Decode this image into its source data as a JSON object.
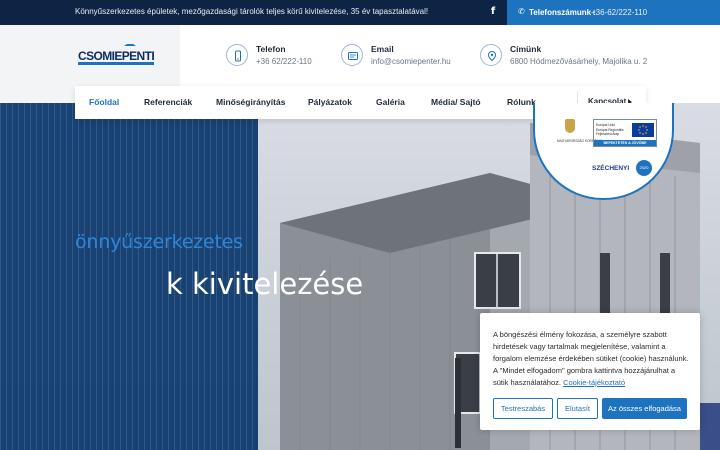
{
  "topbar": {
    "tagline": "Könnyűszerkezetes épületek, mezőgazdasági tárolók teljes körű kivitelezése, 35 év tapasztalatával!",
    "facebook_icon": "facebook-icon",
    "phone_label": "Telefonszámunk :",
    "phone_value": "+36-62/222-110"
  },
  "logo": {
    "text": "CSOMIEPENTER"
  },
  "header": {
    "contacts": [
      {
        "icon": "phone-icon",
        "label": "Telefon",
        "value": "+36 62/222-110"
      },
      {
        "icon": "mail-icon",
        "label": "Email",
        "value": "info@csomiepenter.hu"
      },
      {
        "icon": "location-icon",
        "label": "Címünk",
        "value": "6800 Hódmezővásárhely, Majolika u. 2"
      }
    ]
  },
  "nav": {
    "items": [
      {
        "label": "Főoldal",
        "active": true
      },
      {
        "label": "Referenciák"
      },
      {
        "label": "Minőségirányítás"
      },
      {
        "label": "Pályázatok"
      },
      {
        "label": "Galéria"
      },
      {
        "label": "Média/ Sajtó"
      },
      {
        "label": "Rólunk"
      }
    ],
    "contact_label": "Kapcsolat"
  },
  "hero": {
    "headline_1": "önnyűszerkezetes",
    "headline_2": "k kivitelezése"
  },
  "badge": {
    "eu_bar": "BEFEKTETÉS A JÖVŐBE",
    "szechenyi": "SZÉCHENYI",
    "szechenyi_num": "2020"
  },
  "cookie": {
    "text": "A böngészési élmény fokozása, a személyre szabott hirdetések vagy tartalmak megjelenítése, valamint a forgalom elemzése érdekében sütiket (cookie) használunk. A \"Mindet elfogadom\" gombra kattintva hozzájárulhat a sütik használatához.",
    "link": "Cookie-tájékoztató",
    "btn_settings": "Testreszabás",
    "btn_reject": "Elutasít",
    "btn_accept": "Az összes elfogadása"
  },
  "colors": {
    "topbar_bg": "#0d2444",
    "accent": "#1e73be",
    "hero_overlay": "#0e3a6e"
  }
}
